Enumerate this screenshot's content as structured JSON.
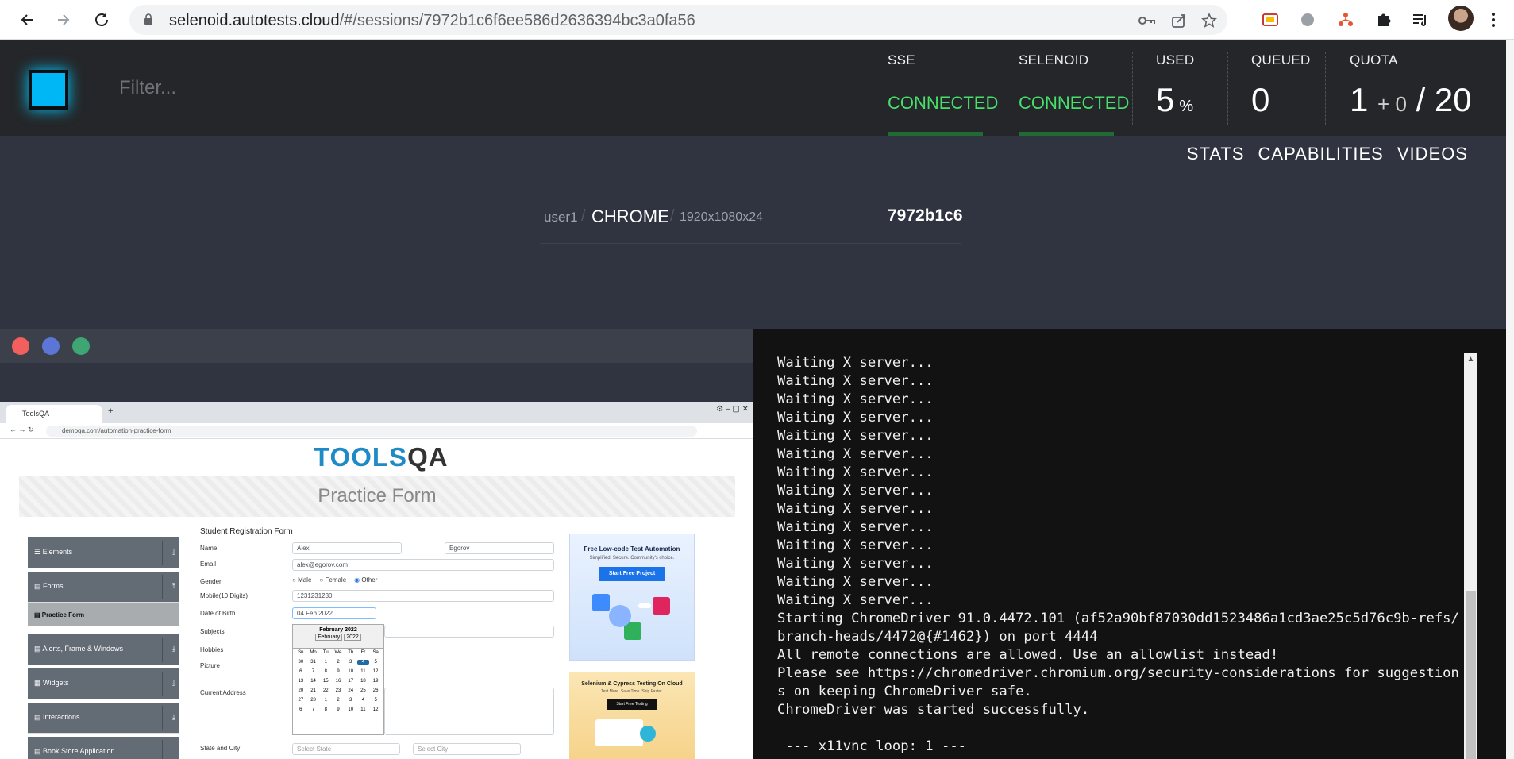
{
  "browser": {
    "url_host": "selenoid.autotests.cloud",
    "url_path": "/#/sessions/7972b1c6f6ee586d2636394bc3a0fa56",
    "nav_icons": [
      "back-icon",
      "forward-icon",
      "reload-icon"
    ],
    "omnibox_icons": [
      "key-icon",
      "share-icon",
      "star-icon"
    ],
    "extension_icons": [
      "cast-icon",
      "extension-gray-icon",
      "extension-tree-icon",
      "puzzle-icon",
      "reading-list-icon"
    ]
  },
  "header": {
    "filter_placeholder": "Filter...",
    "sse": {
      "label": "SSE",
      "status": "CONNECTED"
    },
    "selenoid": {
      "label": "SELENOID",
      "status": "CONNECTED"
    },
    "used": {
      "label": "USED",
      "value": "5",
      "unit": "%"
    },
    "queued": {
      "label": "QUEUED",
      "value": "0"
    },
    "quota": {
      "label": "QUOTA",
      "used": "1",
      "plus": "+ 0",
      "slash_total": "/ 20"
    },
    "accent_green": "#47e06b",
    "logo_color": "#00b7f5"
  },
  "tabs": [
    "STATS",
    "CAPABILITIES",
    "VIDEOS"
  ],
  "session": {
    "user": "user1",
    "browser": "CHROME",
    "resolution": "1920x1080x24",
    "id": "7972b1c6"
  },
  "vnc": {
    "dots": [
      "#f25f5c",
      "#5b76d6",
      "#3da673"
    ],
    "inner": {
      "tab_title": "ToolsQA",
      "url": "demoqa.com/automation-practice-form",
      "logo_main": "TOOLS",
      "logo_accent": "QA",
      "page_title": "Practice Form",
      "sidebar": {
        "elements": "☰ Elements",
        "forms": "▤ Forms",
        "practice_form": "▤ Practice Form",
        "alerts": "▤ Alerts, Frame & Windows",
        "widgets": "▦ Widgets",
        "interactions": "▤ Interactions",
        "book_store": "▤ Book Store Application"
      },
      "form": {
        "title": "Student Registration Form",
        "name_label": "Name",
        "first_name": "Alex",
        "last_name": "Egorov",
        "email_label": "Email",
        "email": "alex@egorov.com",
        "gender_label": "Gender",
        "gender_male": "Male",
        "gender_female": "Female",
        "gender_other": "Other",
        "mobile_label": "Mobile(10 Digits)",
        "mobile": "1231231230",
        "dob_label": "Date of Birth",
        "dob": "04 Feb 2022",
        "subjects_label": "Subjects",
        "hobbies_label": "Hobbies",
        "picture_label": "Picture",
        "address_label": "Current Address",
        "state_city_label": "State and City",
        "state_placeholder": "Select State",
        "city_placeholder": "Select City"
      },
      "calendar": {
        "month_title": "February 2022",
        "month_select": "February",
        "year_select": "2022",
        "weekdays": [
          "Su",
          "Mo",
          "Tu",
          "We",
          "Th",
          "Fr",
          "Sa"
        ],
        "days": [
          "30",
          "31",
          "1",
          "2",
          "3",
          "4",
          "5",
          "6",
          "7",
          "8",
          "9",
          "10",
          "11",
          "12",
          "13",
          "14",
          "15",
          "16",
          "17",
          "18",
          "19",
          "20",
          "21",
          "22",
          "23",
          "24",
          "25",
          "26",
          "27",
          "28",
          "1",
          "2",
          "3",
          "4",
          "5",
          "6",
          "7",
          "8",
          "9",
          "10",
          "11",
          "12"
        ],
        "selected": "4"
      },
      "ad1": {
        "title": "Free Low-code Test Automation",
        "subtitle": "Simplified. Secure. Community's choice.",
        "button": "Start Free Project"
      },
      "ad2": {
        "title": "Selenium & Cypress Testing On Cloud",
        "subtitle": "Test More. Save Time. Ship Faster.",
        "button": "Start Free Testing"
      }
    }
  },
  "terminal": {
    "lines": [
      "Waiting X server...",
      "Waiting X server...",
      "Waiting X server...",
      "Waiting X server...",
      "Waiting X server...",
      "Waiting X server...",
      "Waiting X server...",
      "Waiting X server...",
      "Waiting X server...",
      "Waiting X server...",
      "Waiting X server...",
      "Waiting X server...",
      "Waiting X server...",
      "Waiting X server...",
      "Starting ChromeDriver 91.0.4472.101 (af52a90bf87030dd1523486a1cd3ae25c5d76c9b-refs/branch-heads/4472@{#1462}) on port 4444",
      "All remote connections are allowed. Use an allowlist instead!",
      "Please see https://chromedriver.chromium.org/security-considerations for suggestions on keeping ChromeDriver safe.",
      "ChromeDriver was started successfully.",
      "",
      " --- x11vnc loop: 1 ---"
    ]
  }
}
